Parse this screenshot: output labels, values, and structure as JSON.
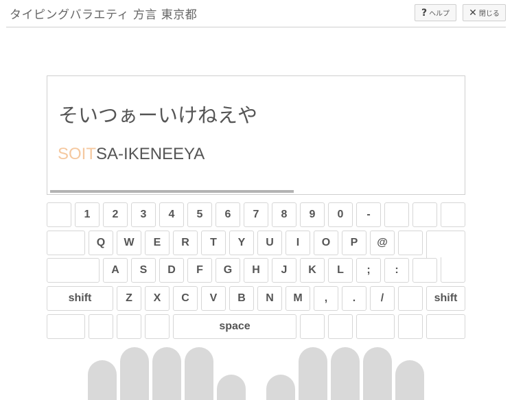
{
  "header": {
    "title": "タイピングバラエティ 方言 東京都",
    "help_icon": "?",
    "help_label": "ヘルプ",
    "close_icon": "✕",
    "close_label": "閉じる"
  },
  "question": {
    "kana": "そいつぁーいけねえや",
    "romaji_typed": "SOIT",
    "romaji_remaining": "SA-IKENEEYA",
    "progress": 0.59
  },
  "keyboard": {
    "row1": [
      "",
      "1",
      "2",
      "3",
      "4",
      "5",
      "6",
      "7",
      "8",
      "9",
      "0",
      "-",
      "",
      "",
      ""
    ],
    "row2": [
      "",
      "Q",
      "W",
      "E",
      "R",
      "T",
      "Y",
      "U",
      "I",
      "O",
      "P",
      "@",
      "",
      ""
    ],
    "row3": [
      "",
      "A",
      "S",
      "D",
      "F",
      "G",
      "H",
      "J",
      "K",
      "L",
      ";",
      ":",
      ""
    ],
    "row4": [
      "shift",
      "Z",
      "X",
      "C",
      "V",
      "B",
      "N",
      "M",
      ",",
      ".",
      "/",
      "",
      "shift"
    ],
    "row5": [
      "",
      "",
      "",
      "",
      "space",
      "",
      "",
      "",
      "",
      ""
    ]
  }
}
